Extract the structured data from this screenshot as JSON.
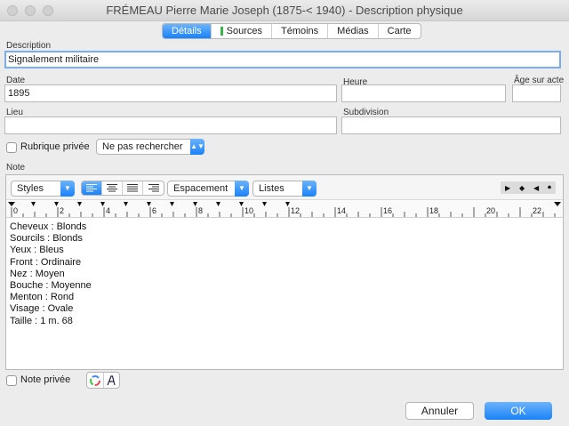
{
  "window": {
    "title": "FRÉMEAU Pierre Marie Joseph (1875-< 1940) - Description physique"
  },
  "tabs": [
    {
      "label": "Détails",
      "active": true
    },
    {
      "label": "Sources",
      "active": false
    },
    {
      "label": "Témoins",
      "active": false
    },
    {
      "label": "Médias",
      "active": false
    },
    {
      "label": "Carte",
      "active": false
    }
  ],
  "form": {
    "description_label": "Description",
    "description_value": "Signalement militaire",
    "date_label": "Date",
    "date_value": "1895",
    "heure_label": "Heure",
    "heure_value": "",
    "age_label": "Âge sur acte",
    "age_value": "",
    "lieu_label": "Lieu",
    "lieu_value": "",
    "subdivision_label": "Subdivision",
    "subdivision_value": "",
    "rubrique_label": "Rubrique privée",
    "search_option": "Ne pas rechercher",
    "note_label": "Note",
    "note_privee_label": "Note privée"
  },
  "editor": {
    "styles_label": "Styles",
    "espacement_label": "Espacement",
    "listes_label": "Listes",
    "ruler_labels": [
      "0",
      "2",
      "4",
      "6",
      "8",
      "10",
      "12",
      "14",
      "16",
      "18",
      "20",
      "22"
    ],
    "lines": [
      "Cheveux : Blonds",
      "Sourcils : Blonds",
      "Yeux : Bleus",
      "Front : Ordinaire",
      "Nez : Moyen",
      "Bouche : Moyenne",
      "Menton : Rond",
      "Visage : Ovale",
      "Taille : 1 m. 68"
    ]
  },
  "buttons": {
    "cancel": "Annuler",
    "ok": "OK"
  },
  "colors": {
    "accent": "#1a82fb",
    "sources_flag": "#3bb54a",
    "background": "#ececec"
  }
}
